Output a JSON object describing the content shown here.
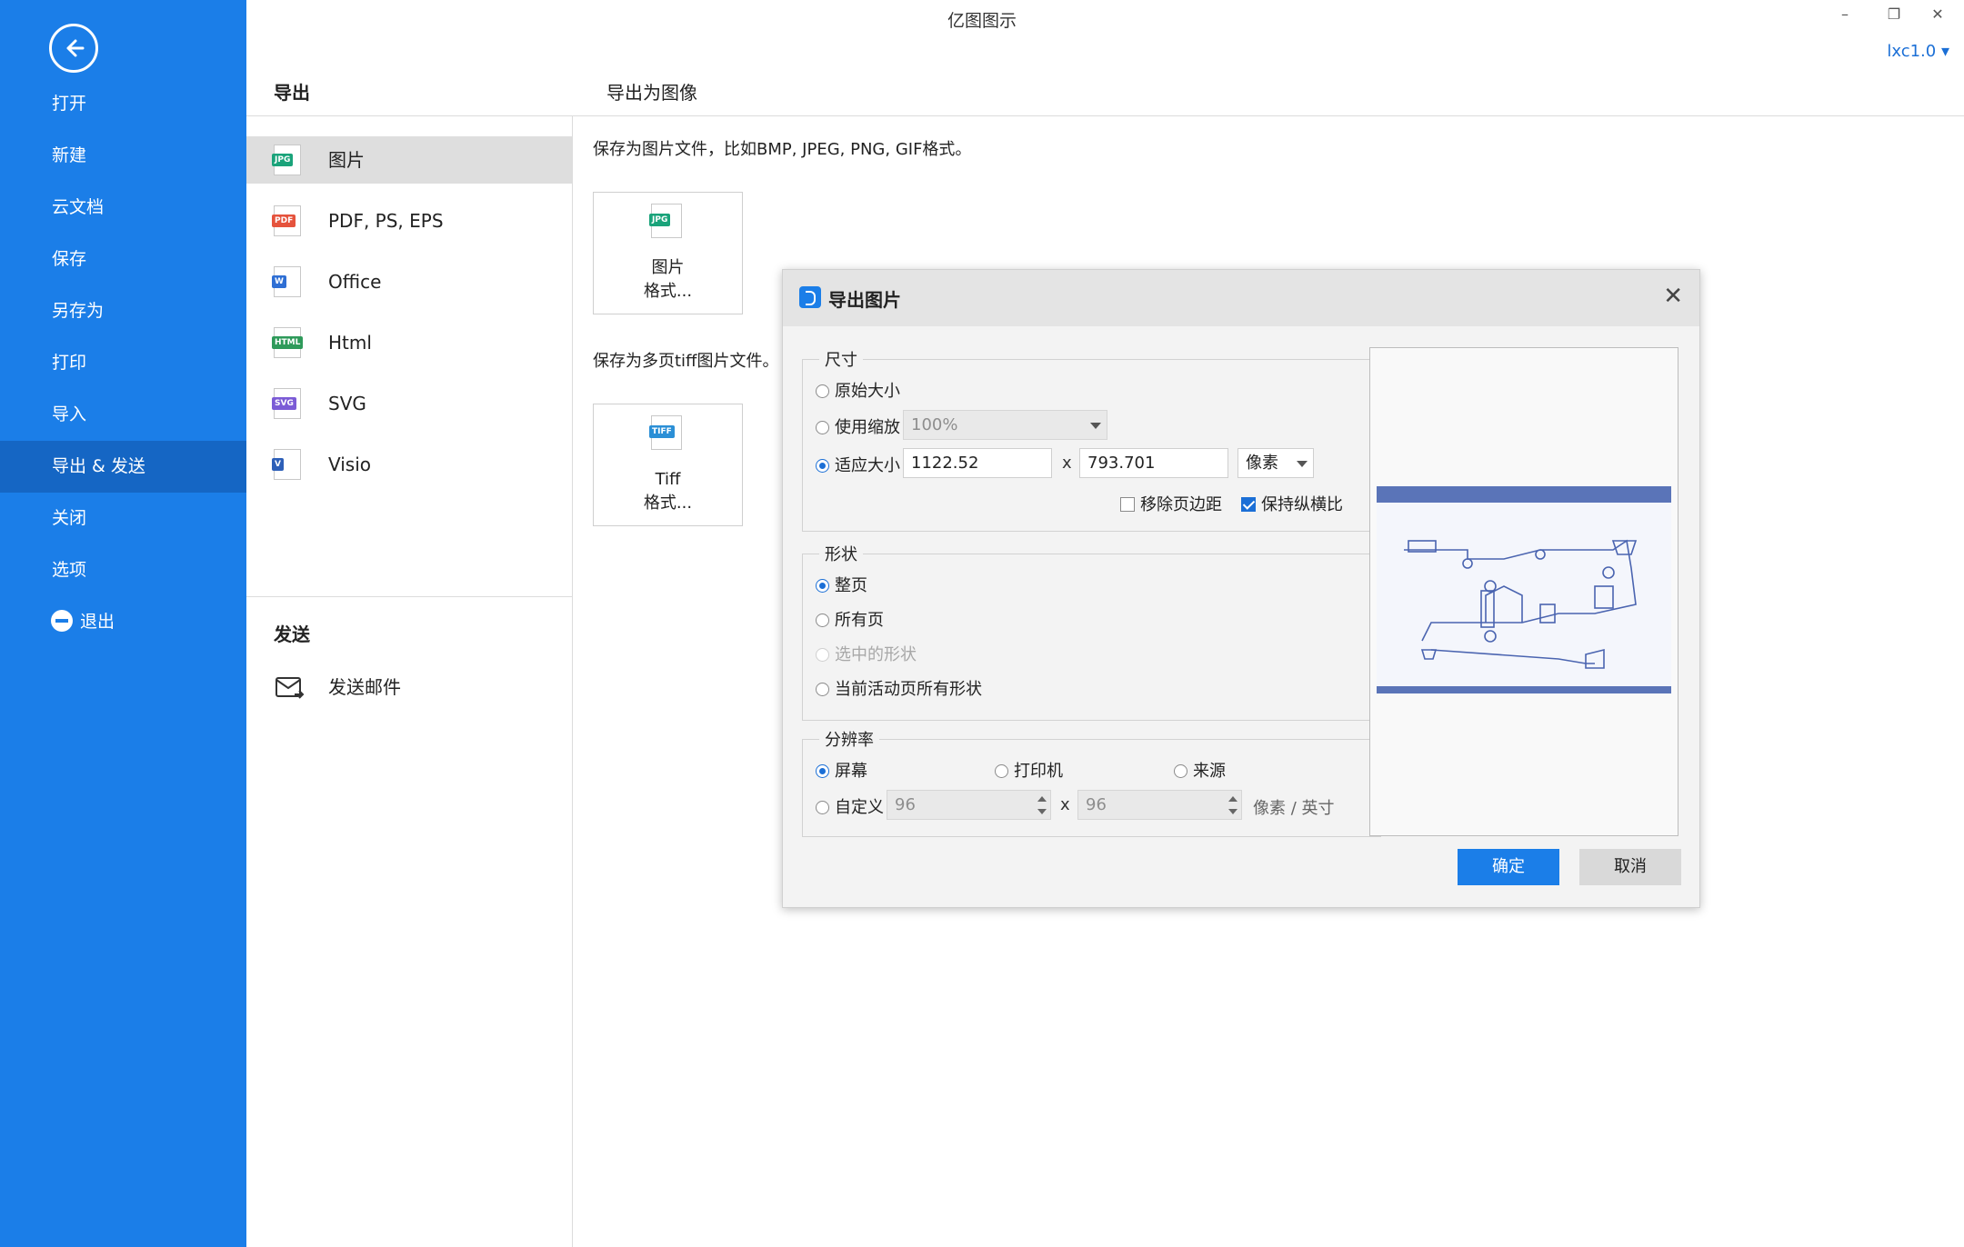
{
  "app": {
    "title": "亿图图示",
    "user": "lxc1.0 ▾"
  },
  "window_controls": {
    "minimize": "–",
    "restore": "❐",
    "close": "✕"
  },
  "sidebar": {
    "items": [
      {
        "label": "打开"
      },
      {
        "label": "新建"
      },
      {
        "label": "云文档"
      },
      {
        "label": "保存"
      },
      {
        "label": "另存为"
      },
      {
        "label": "打印"
      },
      {
        "label": "导入"
      },
      {
        "label": "导出 & 发送",
        "active": true
      },
      {
        "label": "关闭"
      },
      {
        "label": "选项"
      },
      {
        "label": "退出"
      }
    ]
  },
  "export_panel": {
    "heading": "导出",
    "formats": [
      {
        "label": "图片",
        "icon": "jpg-file-icon",
        "tag": "JPG",
        "color": "#1aa37a",
        "active": true
      },
      {
        "label": "PDF, PS, EPS",
        "icon": "pdf-file-icon",
        "tag": "PDF",
        "color": "#e5533d"
      },
      {
        "label": "Office",
        "icon": "word-file-icon",
        "tag": "W",
        "color": "#2f6fd4"
      },
      {
        "label": "Html",
        "icon": "html-file-icon",
        "tag": "HTML",
        "color": "#2e9a5a"
      },
      {
        "label": "SVG",
        "icon": "svg-file-icon",
        "tag": "SVG",
        "color": "#7b5bd6"
      },
      {
        "label": "Visio",
        "icon": "visio-file-icon",
        "tag": "V",
        "color": "#2d5fb8"
      }
    ],
    "send_heading": "发送",
    "send_email": "发送邮件"
  },
  "main": {
    "heading": "导出为图像",
    "image_desc": "保存为图片文件，比如BMP, JPEG, PNG, GIF格式。",
    "image_card": {
      "tag": "JPG",
      "line1": "图片",
      "line2": "格式..."
    },
    "tiff_desc": "保存为多页tiff图片文件。",
    "tiff_card": {
      "tag": "TIFF",
      "line1": "Tiff",
      "line2": "格式..."
    }
  },
  "dialog": {
    "title": "导出图片",
    "close": "✕",
    "size_group": {
      "title": "尺寸",
      "original": "原始大小",
      "use_zoom": "使用缩放",
      "zoom_value": "100%",
      "fit_size": "适应大小",
      "width": "1122.52",
      "times": "x",
      "height": "793.701",
      "unit": "像素",
      "remove_margin": "移除页边距",
      "keep_ratio": "保持纵横比"
    },
    "shape_group": {
      "title": "形状",
      "whole_page": "整页",
      "all_pages": "所有页",
      "selected_shapes": "选中的形状",
      "active_page_shapes": "当前活动页所有形状"
    },
    "resolution_group": {
      "title": "分辨率",
      "screen": "屏幕",
      "printer": "打印机",
      "source": "来源",
      "custom": "自定义",
      "dpi_x": "96",
      "times": "x",
      "dpi_y": "96",
      "unit": "像素 / 英寸"
    },
    "ok": "确定",
    "cancel": "取消"
  },
  "colors": {
    "accent": "#1b7ee8",
    "sidebar_active": "#1566c4"
  }
}
